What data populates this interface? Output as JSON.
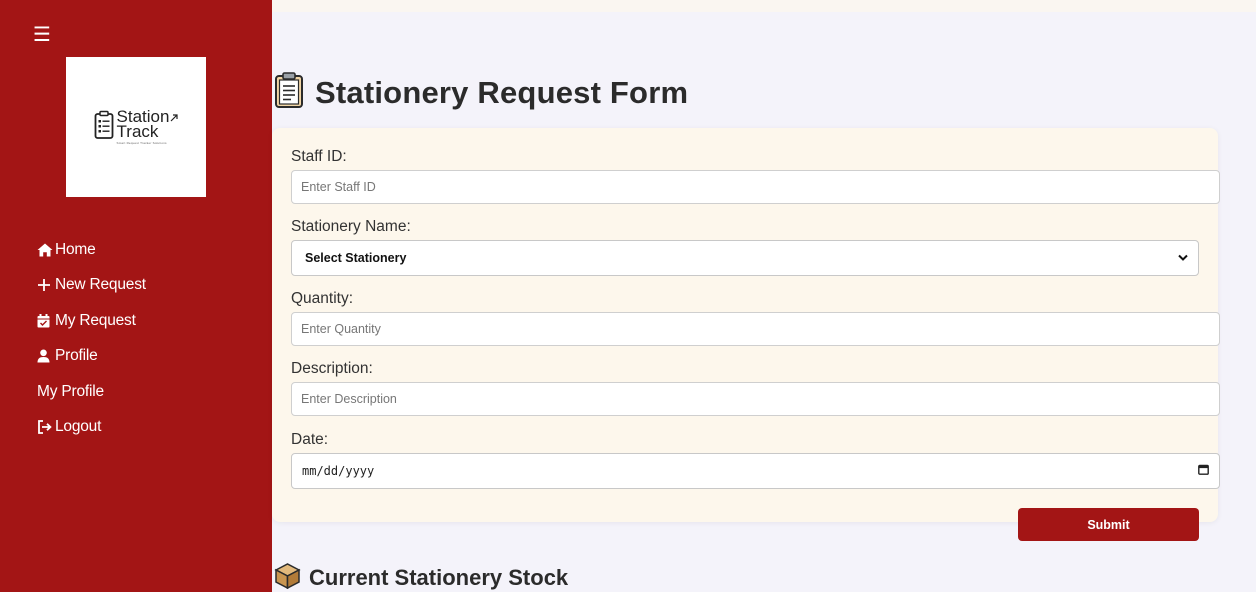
{
  "sidebar": {
    "menu_icon": "☰",
    "logo": {
      "line1": "Station",
      "line2": "Track",
      "tagline": "Smart Request Tracker Solutions",
      "icon": "clipboard-icon"
    },
    "items": [
      {
        "label": "Home",
        "icon": "home-icon"
      },
      {
        "label": "New Request",
        "icon": "plus-icon"
      },
      {
        "label": "My Request",
        "icon": "calendar-check-icon"
      },
      {
        "label": "Profile",
        "icon": "user-icon"
      },
      {
        "label": "My Profile",
        "icon": ""
      },
      {
        "label": "Logout",
        "icon": "logout-icon"
      }
    ]
  },
  "main": {
    "title": "Stationery Request Form",
    "title_icon": "clipboard-icon",
    "form": {
      "staff_id": {
        "label": "Staff ID:",
        "placeholder": "Enter Staff ID"
      },
      "stationery_name": {
        "label": "Stationery Name:",
        "selected": "Select Stationery"
      },
      "quantity": {
        "label": "Quantity:",
        "placeholder": "Enter Quantity"
      },
      "description": {
        "label": "Description:",
        "placeholder": "Enter Description"
      },
      "date": {
        "label": "Date:",
        "value": "mm/dd/yyyy"
      },
      "submit_label": "Submit"
    },
    "stock_title": "Current Stationery Stock",
    "stock_icon": "box-icon"
  },
  "colors": {
    "brand": "#a31515",
    "card": "#fdf7ec",
    "background": "#f4f3fa"
  }
}
